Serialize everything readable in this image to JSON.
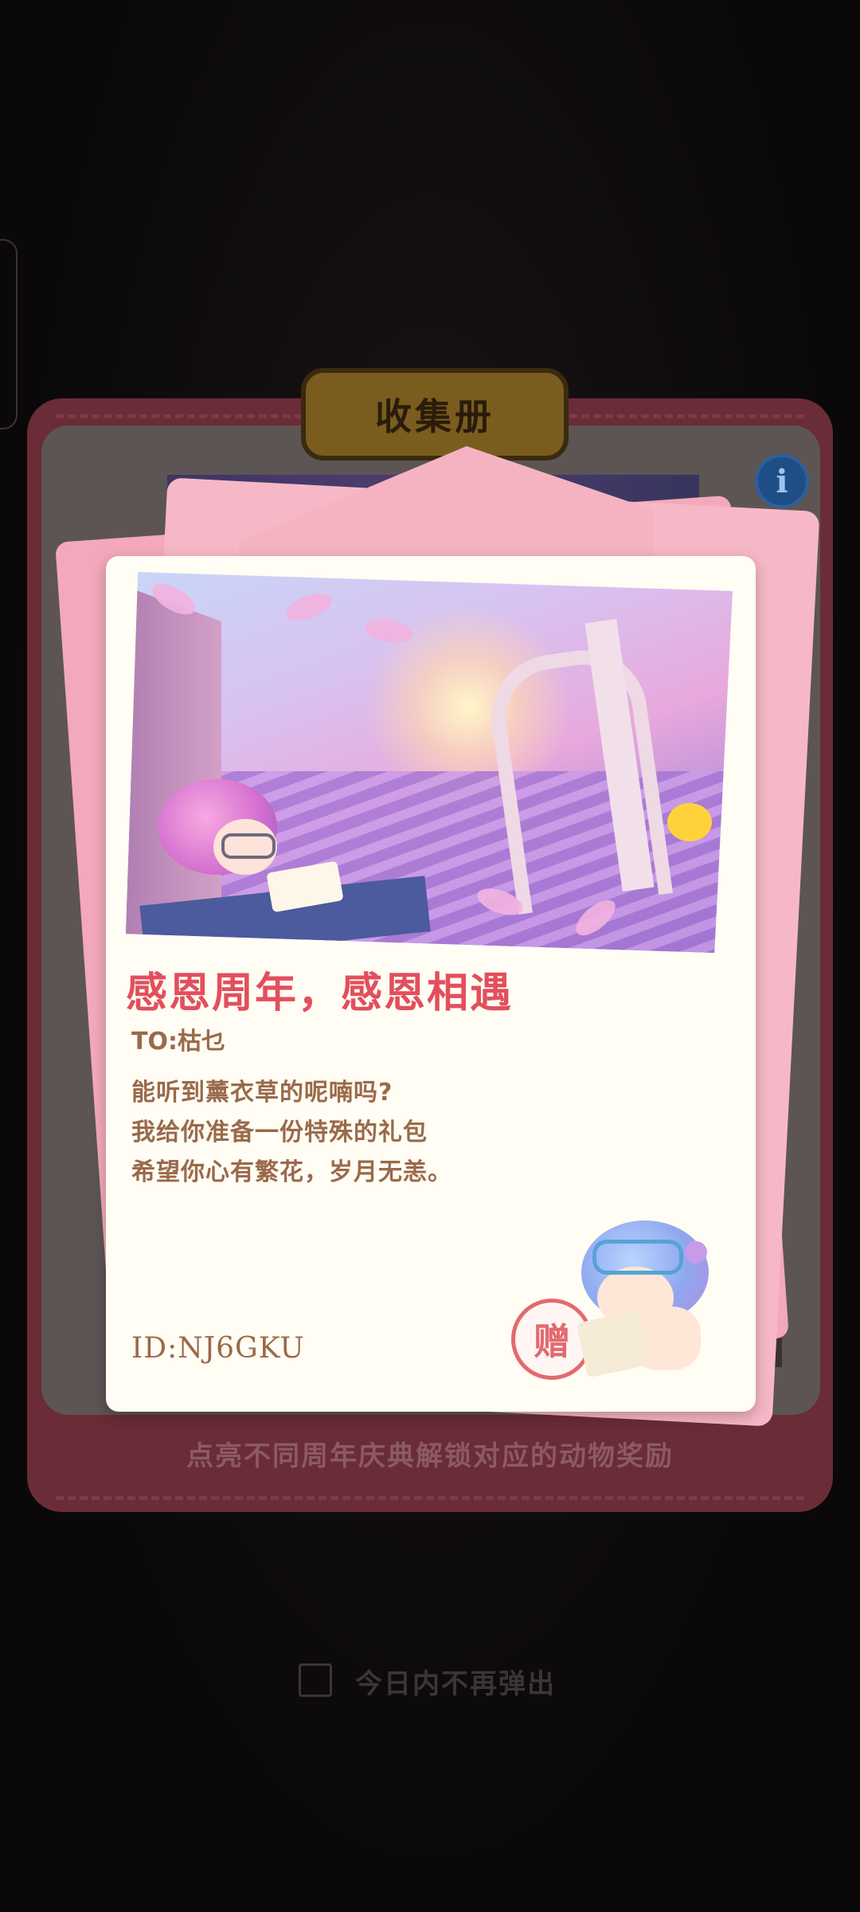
{
  "collection_book": {
    "title": "收集册",
    "footer_text": "点亮不同周年庆典解锁对应的动物奖励",
    "info_icon": "i"
  },
  "card": {
    "title": "感恩周年，感恩相遇",
    "to_line": "TO:枯乜",
    "message_lines": [
      "能听到薰衣草的呢喃吗?",
      "我给你准备一份特殊的礼包",
      "希望你心有繁花，岁月无恙。"
    ],
    "id_text": "ID:NJ6GKU",
    "stamp_text": "赠"
  },
  "footer": {
    "dont_show_today_label": "今日内不再弹出"
  },
  "icons": {
    "info": "info-icon",
    "stamp": "gift-stamp-icon",
    "mascot": "sheep-mascot-icon"
  },
  "colors": {
    "title_red": "#e24f5c",
    "body_brown": "#9a6a4a",
    "envelope_pink": "#f6b8c6",
    "card_bg": "#fffdf4"
  }
}
